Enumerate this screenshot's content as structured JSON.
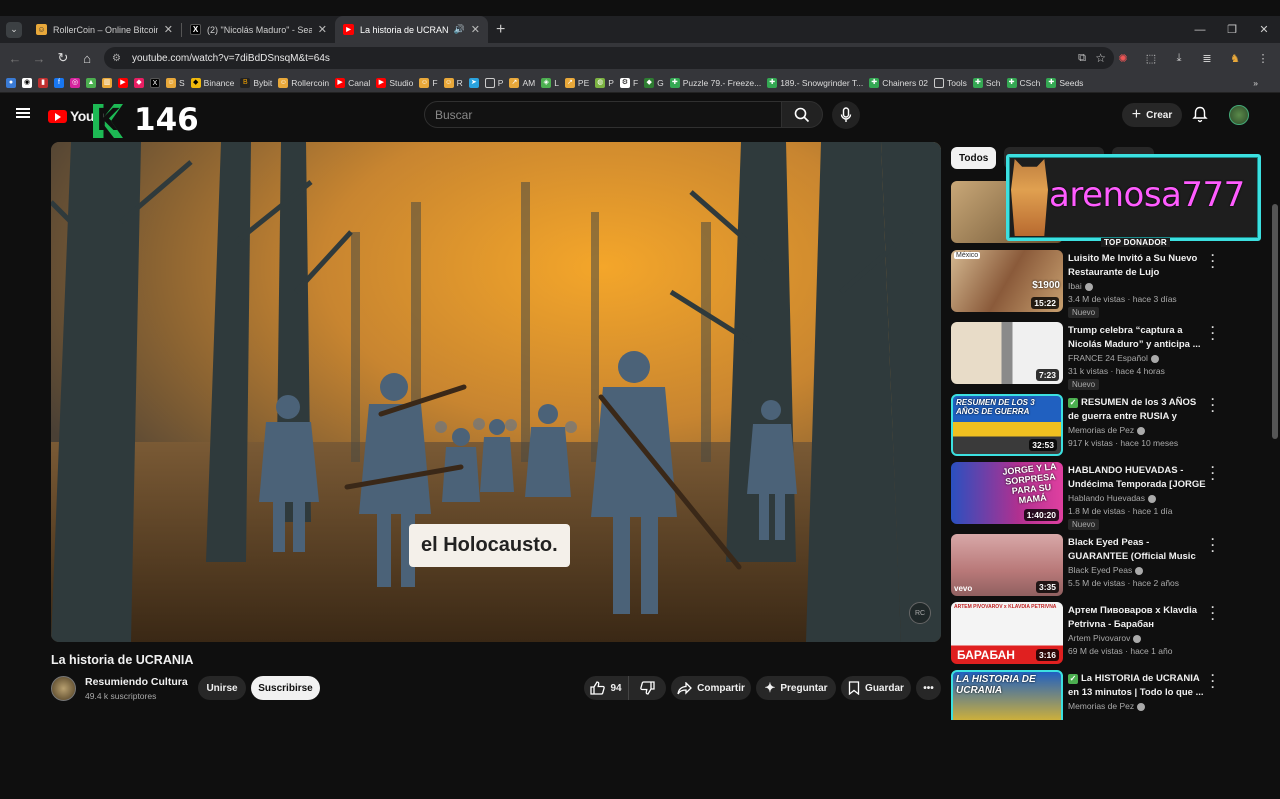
{
  "browser": {
    "tabs": [
      {
        "title": "RollerCoin – Online Bitcoin Mi",
        "color": "#e8a83a",
        "glyph": "😺"
      },
      {
        "title": "(2) \"Nicolás Maduro\" - Search /",
        "color": "#ffffff",
        "glyph": "X"
      },
      {
        "title": "La historia de UCRANIA - Yo",
        "color": "#ff0000",
        "glyph": "▶"
      }
    ],
    "url": "youtube.com/watch?v=7diBdDSnsqM&t=64s",
    "bookmarks": [
      "",
      "",
      "",
      "",
      "",
      "",
      "",
      "",
      "",
      "",
      "S",
      "Binance",
      "Bybit",
      "Rollercoin",
      "Canal",
      "Studio",
      "F",
      "R",
      "",
      "P",
      "AM",
      "L",
      "PE",
      "P",
      "F",
      "G",
      "Puzzle 79.- Freeze...",
      "189.- Snowgrinder T...",
      "Chainers 02",
      "Tools",
      "Sch",
      "CSch",
      "Seeds"
    ]
  },
  "header": {
    "logo_text": "YouTu",
    "overlay_count": "146",
    "search_placeholder": "Buscar",
    "create_label": "Crear"
  },
  "video": {
    "subtitle": "el Holocausto.",
    "watermark": "RC",
    "title": "La historia de UCRANIA",
    "channel": "Resumiendo Cultura",
    "subscribers": "49.4 k suscriptores",
    "join_label": "Unirse",
    "subscribe_label": "Suscribirse",
    "likes": "94",
    "share_label": "Compartir",
    "ask_label": "Preguntar",
    "save_label": "Guardar"
  },
  "chips": [
    "Todos",
    "",
    ""
  ],
  "donor": {
    "name": "arenosa777",
    "tag": "TOP DONADOR"
  },
  "recommendations": [
    {
      "title": "Luisito Me Invitó a Su Nuevo Restaurante de Lujo",
      "channel": "Ibai",
      "meta": "3.4 M de vistas · hace 3 días",
      "duration": "15:22",
      "badge": "Nuevo",
      "checkbox": false,
      "verified": true
    },
    {
      "title": "Trump celebra “captura a Nicolás Maduro” y anticipa ...",
      "channel": "FRANCE 24 Español",
      "meta": "31 k vistas · hace 4 horas",
      "duration": "7:23",
      "badge": "Nuevo",
      "checkbox": false,
      "verified": true
    },
    {
      "title": "RESUMEN de los 3 AÑOS de guerra entre RUSIA y UCRANIA",
      "channel": "Memorias de Pez",
      "meta": "917 k vistas · hace 10 meses",
      "duration": "32:53",
      "badge": "",
      "checkbox": true,
      "verified": true
    },
    {
      "title": "HABLANDO HUEVADAS - Undécima Temporada [JORGE ...",
      "channel": "Hablando Huevadas",
      "meta": "1.8 M de vistas · hace 1 día",
      "duration": "1:40:20",
      "badge": "Nuevo",
      "checkbox": false,
      "verified": true
    },
    {
      "title": "Black Eyed Peas - GUARANTEE (Official Music Video) ft. J. Re...",
      "channel": "Black Eyed Peas",
      "meta": "5.5 M de vistas · hace 2 años",
      "duration": "3:35",
      "badge": "",
      "checkbox": false,
      "verified": true
    },
    {
      "title": "Артем Пивоваров x Klavdia Petrivna - Барабан",
      "channel": "Artem Pivovarov",
      "meta": "69 M de vistas · hace 1 año",
      "duration": "3:16",
      "badge": "",
      "checkbox": false,
      "verified": true
    },
    {
      "title": "La HISTORIA de UCRANIA en 13 minutos | Todo lo que ...",
      "channel": "Memorias de Pez",
      "meta": "",
      "duration": "",
      "badge": "",
      "checkbox": true,
      "verified": true
    }
  ],
  "thumb_texts": {
    "mexico": "México",
    "price": "$1900",
    "resumen": "RESUMEN DE LOS 3 AÑOS DE GUERRA",
    "jorge": "JORGE Y LA SORPRESA PARA SU MAMÁ",
    "vevo": "vevo",
    "artem": "ARTEM PIVOVAROV x KLAVDIA PETRIVNA",
    "baraban": "БАРАБАН",
    "historia": "LA HISTORIA DE UCRANIA"
  }
}
